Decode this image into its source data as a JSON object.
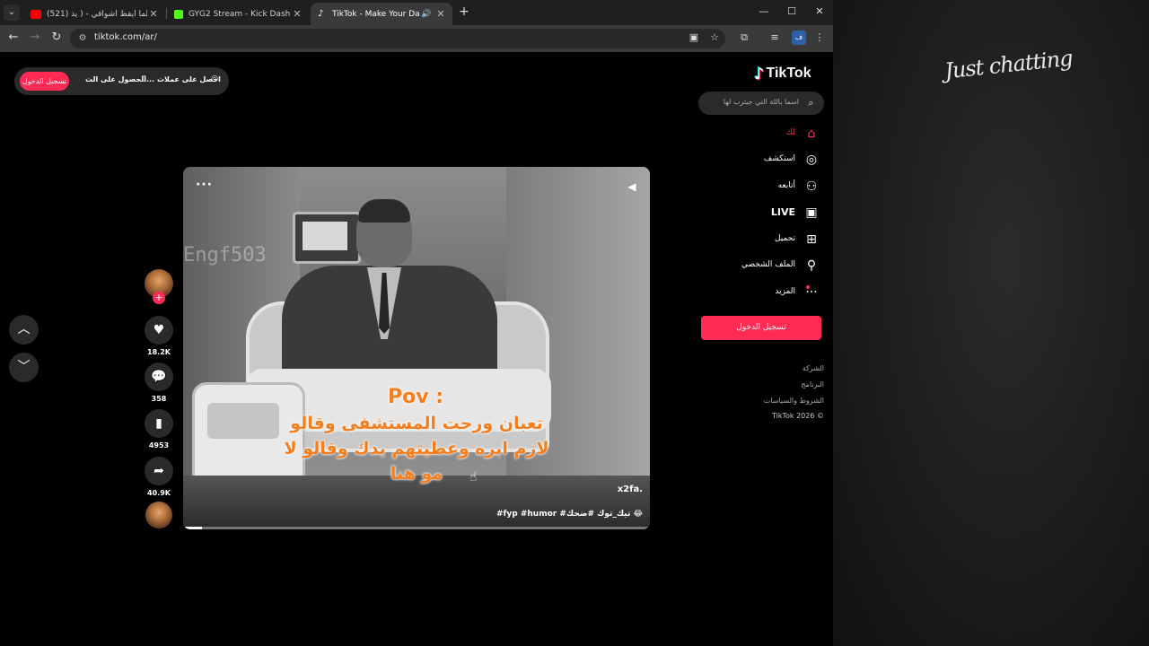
{
  "browser": {
    "tabs": [
      {
        "title": "(521) يا حلما ايقظ أشواقي - ( يذ...",
        "favicon": "youtube-icon",
        "color": "#ff0000"
      },
      {
        "title": "GYG2 Stream - Kick Dashboard",
        "favicon": "kick-icon",
        "color": "#53fc18"
      },
      {
        "title": "TikTok - Make Your Day",
        "favicon": "tiktok-icon",
        "color": "#ffffff",
        "active": true
      }
    ],
    "url": "tiktok.com/ar/",
    "profile_initial": "ف"
  },
  "tiktok": {
    "logo_text": "TikTok",
    "search_placeholder": "اسما ياللة التي جيترب لها",
    "top_actions": {
      "login": "تسجيل الدخول",
      "get_app": "الحصول على الت...",
      "get_coins": "احصل على عملات"
    },
    "nav": [
      {
        "label": "لك",
        "icon": "home-icon",
        "active": true
      },
      {
        "label": "استكشف",
        "icon": "compass-icon"
      },
      {
        "label": "أتابعه",
        "icon": "following-icon"
      },
      {
        "label": "LIVE",
        "icon": "live-icon"
      },
      {
        "label": "تحميل",
        "icon": "upload-icon"
      },
      {
        "label": "الملف الشخصي",
        "icon": "profile-icon"
      },
      {
        "label": "المزيد",
        "icon": "more-icon"
      }
    ],
    "sidebar_login": "تسجيل الدخول",
    "footer": [
      "الشركة",
      "البرنامج",
      "الشروط والسياسات",
      "TikTok 2026 ©"
    ],
    "video": {
      "watermark": "Engf503",
      "caption_title": "Pov :",
      "caption_body": "تعبان ورحت المستشفى وقالو لازم ابره وعطيتهم يدك وقالو لا مو هنا",
      "handle": "x2fa.",
      "tags": "#fyp #humor #تيك_توك #ضحك 😂",
      "progress": 0.04
    },
    "actions": {
      "likes": "18.2K",
      "comments": "358",
      "saves": "4953",
      "shares": "40.9K"
    }
  },
  "overlay": {
    "brand": "Just chatting"
  },
  "colors": {
    "accent": "#fe2c55",
    "caption": "#f57e1e"
  }
}
